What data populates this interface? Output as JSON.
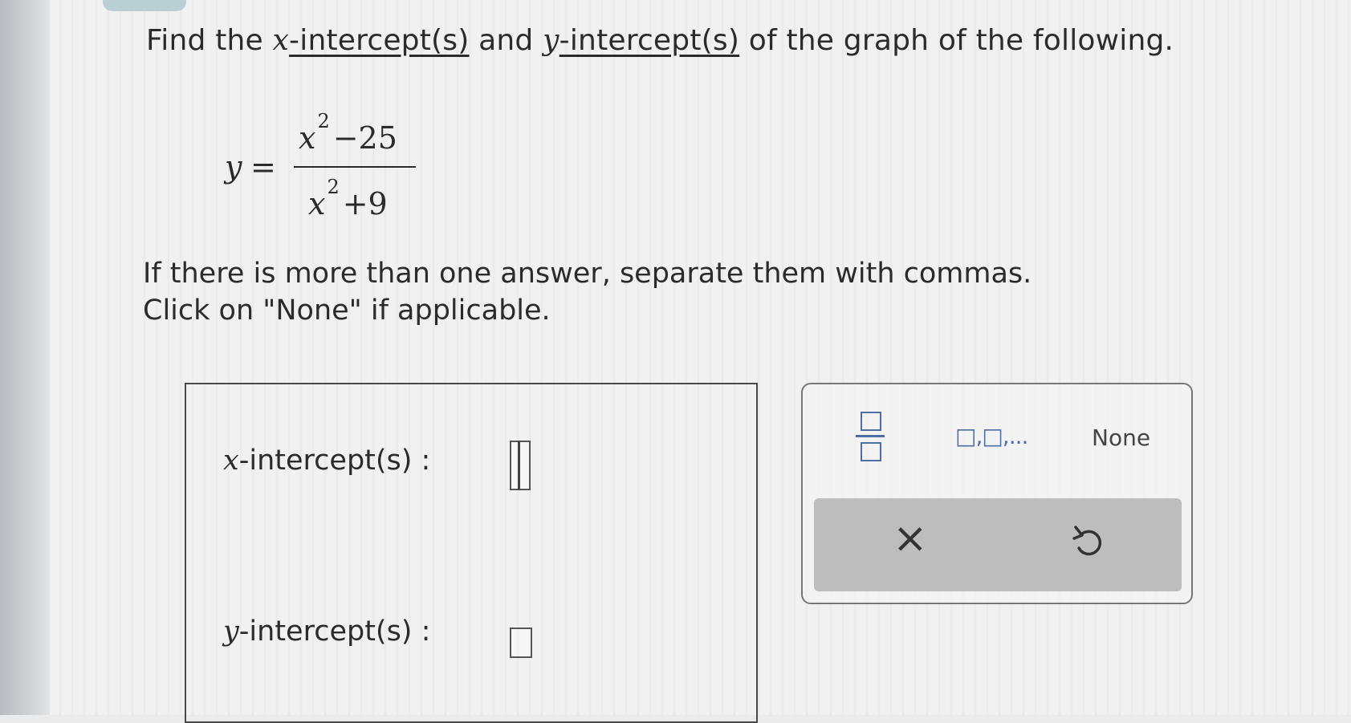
{
  "question": {
    "part1": "Find the ",
    "x_var": "x",
    "x_intercept_link": "-intercept(s)",
    "part2": " and ",
    "y_var": "y",
    "y_intercept_link": "-intercept(s)",
    "part3": " of the graph of the following."
  },
  "equation": {
    "lhs": "y",
    "equals": "=",
    "numerator_base": "x",
    "numerator_exp": "2",
    "numerator_rest": "−25",
    "denominator_base": "x",
    "denominator_exp": "2",
    "denominator_rest": "+9"
  },
  "instructions": {
    "line1": "If there is more than one answer, separate them with commas.",
    "line2": "Click on \"None\" if applicable."
  },
  "answers": {
    "x_label_var": "x",
    "x_label_text": "-intercept(s) :",
    "x_value": "",
    "y_label_var": "y",
    "y_label_text": "-intercept(s) :",
    "y_value": ""
  },
  "keypad": {
    "list_label": "□,□,...",
    "none_label": "None",
    "clear_label": "×",
    "fraction_icon": "fraction-template-icon",
    "undo_icon": "undo-icon"
  },
  "colors": {
    "keypad_accent": "#4e6fa6",
    "action_bar": "#bdbdbd"
  }
}
